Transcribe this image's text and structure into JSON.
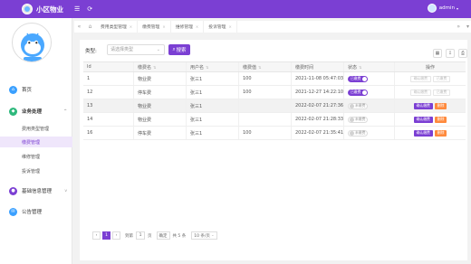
{
  "header": {
    "app_title": "小区物业",
    "menu_icon": "hamburger-icon",
    "refresh_icon": "refresh-icon",
    "user_name": "admin",
    "user_caret": "▾"
  },
  "sidebar": {
    "items": [
      {
        "label": "首页",
        "icon": "home-icon",
        "color": "#3aa0ff"
      },
      {
        "label": "业务处理",
        "icon": "business-icon",
        "color": "#2db87c"
      },
      {
        "label": "基础信息管理",
        "icon": "info-icon",
        "color": "#7b3fd3"
      },
      {
        "label": "公告管理",
        "icon": "notice-icon",
        "color": "#3aa0ff"
      }
    ],
    "sub_items": [
      "费用类型管理",
      "缴费管理",
      "维修管理",
      "投诉管理"
    ],
    "chev_up": "^",
    "chev_down": "v"
  },
  "tabs": {
    "items": [
      "费用类型管理",
      "缴费管理",
      "维修管理",
      "投诉管理"
    ],
    "close_mark": "×"
  },
  "filter": {
    "label": "类型:",
    "select_placeholder": "请选择类型",
    "search_label": "搜索"
  },
  "table": {
    "headers": [
      "Id",
      "缴费名",
      "用户名",
      "缴费值",
      "缴费时间",
      "状态",
      "操作"
    ],
    "rows": [
      {
        "id": "1",
        "name": "物业费",
        "user": "张三1",
        "amount": "100",
        "time": "2021-11-08 05:47:03",
        "status": "已缴费",
        "paid": true
      },
      {
        "id": "12",
        "name": "停车费",
        "user": "张三1",
        "amount": "100",
        "time": "2021-12-27 14:22:10",
        "status": "已缴费",
        "paid": true
      },
      {
        "id": "13",
        "name": "物业费",
        "user": "张三1",
        "amount": "",
        "time": "2022-02-07 21:27:36",
        "status": "未缴费",
        "paid": false
      },
      {
        "id": "14",
        "name": "物业费",
        "user": "张三1",
        "amount": "",
        "time": "2022-02-07 21:28:33",
        "status": "未缴费",
        "paid": false
      },
      {
        "id": "16",
        "name": "停车费",
        "user": "张三1",
        "amount": "100",
        "time": "2022-02-07 21:35:41",
        "status": "未缴费",
        "paid": false
      }
    ],
    "btn_confirm": "确认缴费",
    "btn_confirm_done": "确认缴费",
    "btn_paid": "已缴费",
    "btn_delete": "删除"
  },
  "pager": {
    "current": "1",
    "goto_label": "到第",
    "page_input": "1",
    "page_unit": "页",
    "go_label": "确定",
    "total": "共 5 条",
    "per_page": "10 条/页"
  }
}
